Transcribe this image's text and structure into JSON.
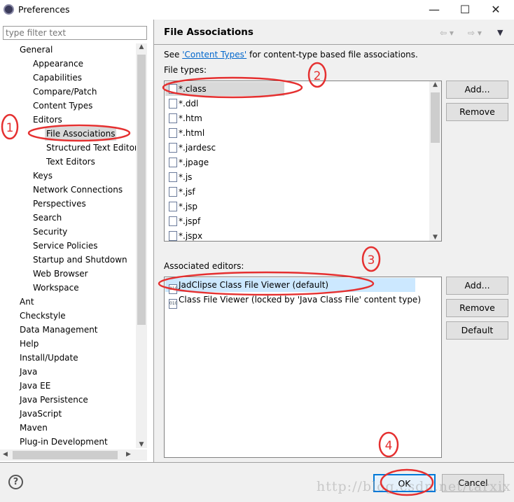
{
  "window": {
    "title": "Preferences",
    "minimize": "—",
    "maximize": "☐",
    "close": "✕"
  },
  "sidebar": {
    "filter_placeholder": "type filter text",
    "items": [
      {
        "label": "General",
        "level": 0
      },
      {
        "label": "Appearance",
        "level": 1
      },
      {
        "label": "Capabilities",
        "level": 1
      },
      {
        "label": "Compare/Patch",
        "level": 1
      },
      {
        "label": "Content Types",
        "level": 1
      },
      {
        "label": "Editors",
        "level": 1
      },
      {
        "label": "File Associations",
        "level": 2,
        "selected": true
      },
      {
        "label": "Structured Text Editor",
        "level": 2
      },
      {
        "label": "Text Editors",
        "level": 2
      },
      {
        "label": "Keys",
        "level": 1
      },
      {
        "label": "Network Connections",
        "level": 1
      },
      {
        "label": "Perspectives",
        "level": 1
      },
      {
        "label": "Search",
        "level": 1
      },
      {
        "label": "Security",
        "level": 1
      },
      {
        "label": "Service Policies",
        "level": 1
      },
      {
        "label": "Startup and Shutdown",
        "level": 1
      },
      {
        "label": "Web Browser",
        "level": 1
      },
      {
        "label": "Workspace",
        "level": 1
      },
      {
        "label": "Ant",
        "level": 0
      },
      {
        "label": "Checkstyle",
        "level": 0
      },
      {
        "label": "Data Management",
        "level": 0
      },
      {
        "label": "Help",
        "level": 0
      },
      {
        "label": "Install/Update",
        "level": 0
      },
      {
        "label": "Java",
        "level": 0
      },
      {
        "label": "Java EE",
        "level": 0
      },
      {
        "label": "Java Persistence",
        "level": 0
      },
      {
        "label": "JavaScript",
        "level": 0
      },
      {
        "label": "Maven",
        "level": 0
      },
      {
        "label": "Plug-in Development",
        "level": 0
      }
    ]
  },
  "page": {
    "title": "File Associations",
    "desc_pre": "See ",
    "desc_link": "'Content Types'",
    "desc_post": " for content-type based file associations.",
    "file_types_label": "File types:",
    "file_types": [
      "*.class",
      "*.ddl",
      "*.htm",
      "*.html",
      "*.jardesc",
      "*.jpage",
      "*.js",
      "*.jsf",
      "*.jsp",
      "*.jspf",
      "*.jspx"
    ],
    "editors_label": "Associated editors:",
    "editors": [
      "JadClipse Class File Viewer (default)",
      "Class File Viewer (locked by 'Java Class File' content type)"
    ],
    "add": "Add...",
    "remove": "Remove",
    "default": "Default"
  },
  "footer": {
    "help": "?",
    "ok": "OK",
    "cancel": "Cancel",
    "watermark": "http://blog.csdn.net/tarxix"
  },
  "annotations": [
    "1",
    "2",
    "3",
    "4"
  ],
  "colors": {
    "selection": "#cce8ff",
    "annotation": "#e53030",
    "link": "#0066cc",
    "focus": "#0078d7"
  }
}
